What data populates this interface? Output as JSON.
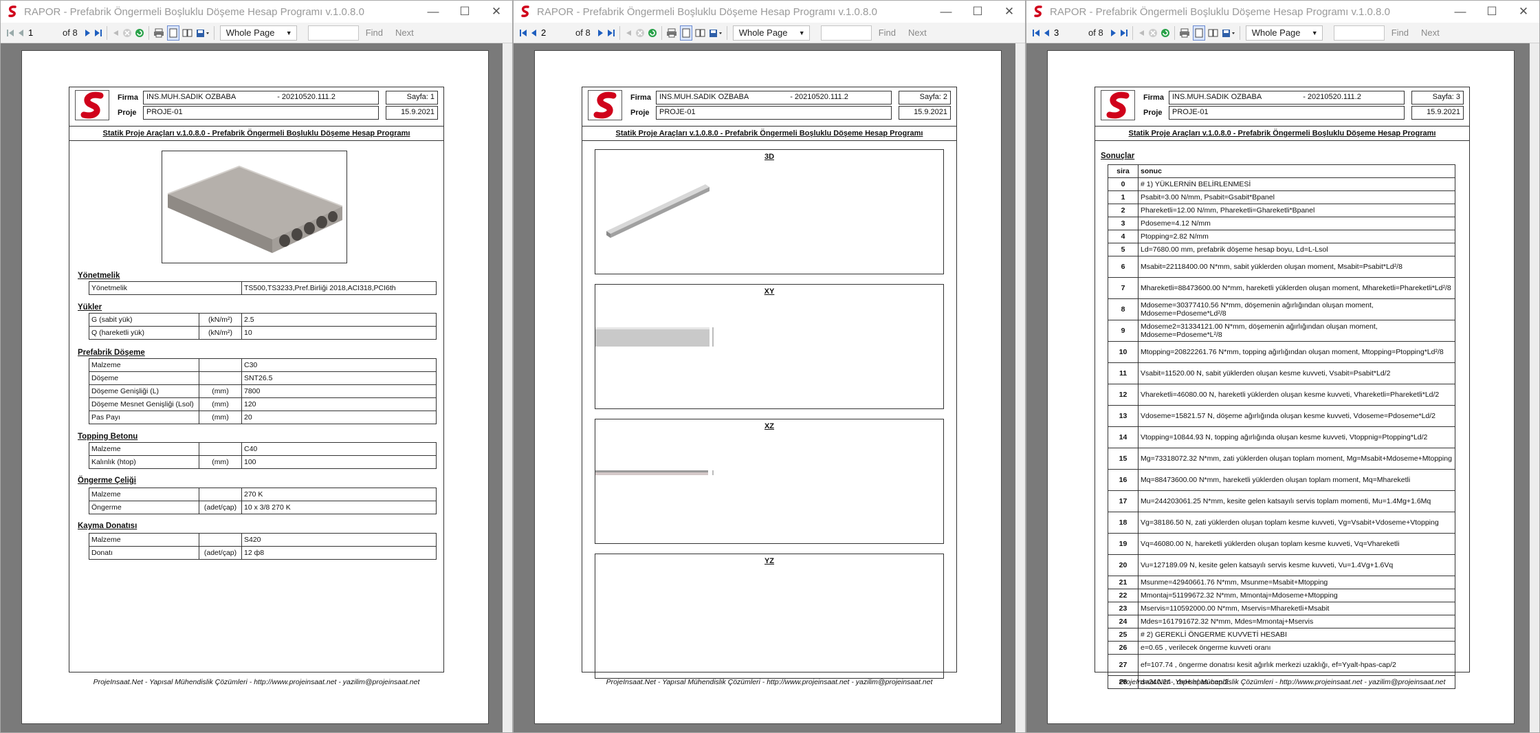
{
  "windows": [
    {
      "title": "RAPOR - Prefabrik Öngermeli Boşluklu Döşeme Hesap Programı v.1.0.8.0",
      "toolbar": {
        "page": "1",
        "of": "of 8",
        "zoom": "Whole Page",
        "find": "Find",
        "next": "Next"
      },
      "header": {
        "firma_label": "Firma",
        "proje_label": "Proje",
        "firma": "INS.MUH.SADIK OZBABA",
        "code": "- 20210520.111.2",
        "proje": "PROJE-01",
        "sayfa": "Sayfa: 1",
        "date": "15.9.2021"
      }
    },
    {
      "title": "RAPOR - Prefabrik Öngermeli Boşluklu Döşeme Hesap Programı v.1.0.8.0",
      "toolbar": {
        "page": "2",
        "of": "of 8",
        "zoom": "Whole Page",
        "find": "Find",
        "next": "Next"
      },
      "header": {
        "firma_label": "Firma",
        "proje_label": "Proje",
        "firma": "INS.MUH.SADIK OZBABA",
        "code": "- 20210520.111.2",
        "proje": "PROJE-01",
        "sayfa": "Sayfa: 2",
        "date": "15.9.2021"
      }
    },
    {
      "title": "RAPOR - Prefabrik Öngermeli Boşluklu Döşeme Hesap Programı v.1.0.8.0",
      "toolbar": {
        "page": "3",
        "of": "of 8",
        "zoom": "Whole Page",
        "find": "Find",
        "next": "Next"
      },
      "header": {
        "firma_label": "Firma",
        "proje_label": "Proje",
        "firma": "INS.MUH.SADIK OZBABA",
        "code": "- 20210520.111.2",
        "proje": "PROJE-01",
        "sayfa": "Sayfa: 3",
        "date": "15.9.2021"
      }
    }
  ],
  "report_title": "Statik Proje Araçları v.1.0.8.0 - Prefabrik Öngermeli Boşluklu Döşeme Hesap Programı",
  "footer": "ProjeInsaat.Net - Yapısal Mühendislik Çözümleri - http://www.projeinsaat.net - yazilim@projeinsaat.net",
  "page1": {
    "yonetmelik": {
      "heading": "Yönetmelik",
      "label": "Yönetmelik",
      "value": "TS500,TS3233,Pref.Birliği 2018,ACI318,PCI6th"
    },
    "yukler": {
      "heading": "Yükler",
      "rows": [
        {
          "name": "G (sabit yük)",
          "unit": "(kN/m²)",
          "value": "2.5"
        },
        {
          "name": "Q (hareketli yük)",
          "unit": "(kN/m²)",
          "value": "10"
        }
      ]
    },
    "doseme": {
      "heading": "Prefabrik Döşeme",
      "rows": [
        {
          "name": "Malzeme",
          "unit": "",
          "value": "C30"
        },
        {
          "name": "Döşeme",
          "unit": "",
          "value": "SNT26.5"
        },
        {
          "name": "Döşeme Genişliği (L)",
          "unit": "(mm)",
          "value": "7800"
        },
        {
          "name": "Döşeme Mesnet Genişliği (Lsol)",
          "unit": "(mm)",
          "value": "120"
        },
        {
          "name": "Pas Payı",
          "unit": "(mm)",
          "value": "20"
        }
      ]
    },
    "topping": {
      "heading": "Topping Betonu",
      "rows": [
        {
          "name": "Malzeme",
          "unit": "",
          "value": "C40"
        },
        {
          "name": "Kalınlık (htop)",
          "unit": "(mm)",
          "value": "100"
        }
      ]
    },
    "celik": {
      "heading": "Öngerme Çeliği",
      "rows": [
        {
          "name": "Malzeme",
          "unit": "",
          "value": "270 K"
        },
        {
          "name": "Öngerme",
          "unit": "(adet/çap)",
          "value": "10 x 3/8 270 K"
        }
      ]
    },
    "kayma": {
      "heading": "Kayma Donatısı",
      "rows": [
        {
          "name": "Malzeme",
          "unit": "",
          "value": "S420"
        },
        {
          "name": "Donatı",
          "unit": "(adet/çap)",
          "value": "12 ф8"
        }
      ]
    }
  },
  "page2": {
    "views": [
      "3D",
      "XY",
      "XZ",
      "YZ"
    ]
  },
  "page3": {
    "heading": "Sonuçlar",
    "col_sira": "sira",
    "col_sonuc": "sonuc",
    "rows": [
      {
        "n": "0",
        "t": "# 1) YÜKLERNİN BELİRLENMESİ"
      },
      {
        "n": "1",
        "t": "Psabit=3.00 N/mm, Psabit=Gsabit*Bpanel"
      },
      {
        "n": "2",
        "t": "Phareketli=12.00 N/mm, Phareketli=Ghareketli*Bpanel"
      },
      {
        "n": "3",
        "t": "Pdoseme=4.12 N/mm"
      },
      {
        "n": "4",
        "t": "Ptopping=2.82 N/mm"
      },
      {
        "n": "5",
        "t": "Ld=7680.00 mm, prefabrik döşeme hesap boyu, Ld=L-Lsol"
      },
      {
        "n": "6",
        "t": "Msabit=22118400.00 N*mm, sabit yüklerden oluşan moment, Msabit=Psabit*Ld²/8"
      },
      {
        "n": "7",
        "t": "Mhareketli=88473600.00 N*mm, hareketli yüklerden oluşan moment, Mhareketli=Phareketli*Ld²/8"
      },
      {
        "n": "8",
        "t": "Mdoseme=30377410.56 N*mm, döşemenin ağırlığından oluşan moment, Mdoseme=Pdoseme*Ld²/8"
      },
      {
        "n": "9",
        "t": "Mdoseme2=31334121.00 N*mm, döşemenin ağırlığından oluşan moment, Mdoseme=Pdoseme*L²/8"
      },
      {
        "n": "10",
        "t": "Mtopping=20822261.76 N*mm, topping ağırlığından oluşan moment, Mtopping=Ptopping*Ld²/8"
      },
      {
        "n": "11",
        "t": "Vsabit=11520.00 N, sabit yüklerden oluşan kesme kuvveti, Vsabit=Psabit*Ld/2"
      },
      {
        "n": "12",
        "t": "Vhareketli=46080.00 N, hareketli yüklerden oluşan kesme kuvveti, Vhareketli=Phareketli*Ld/2"
      },
      {
        "n": "13",
        "t": "Vdoseme=15821.57 N, döşeme ağırlığında oluşan kesme kuvveti, Vdoseme=Pdoseme*Ld/2"
      },
      {
        "n": "14",
        "t": "Vtopping=10844.93 N, topping ağırlığında oluşan kesme kuvveti, Vtoppnig=Ptopping*Ld/2"
      },
      {
        "n": "15",
        "t": "Mg=73318072.32 N*mm, zati yüklerden oluşan toplam moment, Mg=Msabit+Mdoseme+Mtopping"
      },
      {
        "n": "16",
        "t": "Mq=88473600.00 N*mm, hareketli yüklerden oluşan toplam moment, Mq=Mhareketli"
      },
      {
        "n": "17",
        "t": "Mu=244203061.25 N*mm, kesite gelen katsayılı servis toplam momenti, Mu=1.4Mg+1.6Mq"
      },
      {
        "n": "18",
        "t": "Vg=38186.50 N, zati yüklerden oluşan toplam kesme kuvveti, Vg=Vsabit+Vdoseme+Vtopping"
      },
      {
        "n": "19",
        "t": "Vq=46080.00 N, hareketli yüklerden oluşan toplam kesme kuvveti, Vq=Vhareketli"
      },
      {
        "n": "20",
        "t": "Vu=127189.09 N, kesite gelen katsayılı servis kesme kuvveti, Vu=1.4Vg+1.6Vq"
      },
      {
        "n": "21",
        "t": "Msunme=42940661.76 N*mm, Msunme=Msabit+Mtopping"
      },
      {
        "n": "22",
        "t": "Mmontaj=51199672.32 N*mm, Mmontaj=Mdoseme+Mtopping"
      },
      {
        "n": "23",
        "t": "Mservis=110592000.00 N*mm, Mservis=Mhareketli+Msabit"
      },
      {
        "n": "24",
        "t": "Mdes=161791672.32 N*mm, Mdes=Mmontaj+Mservis"
      },
      {
        "n": "25",
        "t": "# 2) GEREKLİ ÖNGERME KUVVETİ HESABI"
      },
      {
        "n": "26",
        "t": "e=0.65 , verilecek öngerme kuvveti oranı"
      },
      {
        "n": "27",
        "t": "ef=107.74 , öngerme donatısı kesit ağırlık merkezi uzaklığı, ef=Yyalt-hpas-cap/2"
      },
      {
        "n": "28",
        "t": "d=240.24 , d=H-hpas-cap/2"
      }
    ]
  },
  "colors": {
    "accent": "#d0021b",
    "viewer_bg": "#7a7a7a",
    "nav_blue": "#1f5fbf"
  }
}
